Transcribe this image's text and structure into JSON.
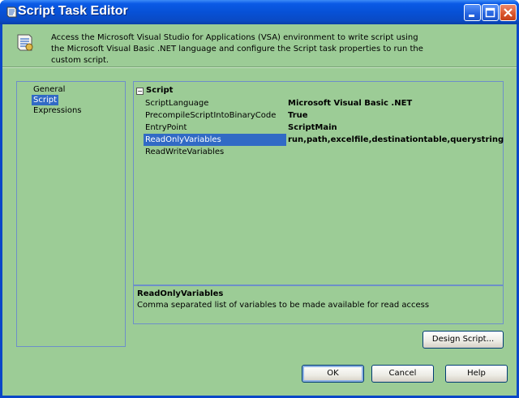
{
  "window": {
    "title": "Script Task Editor"
  },
  "header": {
    "description": "Access the Microsoft Visual Studio for Applications (VSA) environment to write script using the Microsoft Visual Basic .NET language and configure the Script task properties to run the custom script."
  },
  "nav": {
    "items": [
      {
        "label": "General",
        "selected": false
      },
      {
        "label": "Script",
        "selected": true
      },
      {
        "label": "Expressions",
        "selected": false
      }
    ]
  },
  "grid": {
    "category": "Script",
    "toggle_symbol": "⊟",
    "properties": [
      {
        "name": "ScriptLanguage",
        "value": "Microsoft Visual Basic .NET"
      },
      {
        "name": "PrecompileScriptIntoBinaryCode",
        "value": "True"
      },
      {
        "name": "EntryPoint",
        "value": "ScriptMain"
      },
      {
        "name": "ReadOnlyVariables",
        "value": "run,path,excelfile,destinationtable,querystring"
      },
      {
        "name": "ReadWriteVariables",
        "value": ""
      }
    ],
    "selected_property": "ReadOnlyVariables"
  },
  "description": {
    "title": "ReadOnlyVariables",
    "body": "Comma separated list of variables to be made available for read access"
  },
  "buttons": {
    "design_script": "Design Script...",
    "ok": "OK",
    "cancel": "Cancel",
    "help": "Help"
  },
  "colors": {
    "background": "#9ccc96",
    "selection": "#316ac5",
    "titlebar": "#0751d6"
  }
}
